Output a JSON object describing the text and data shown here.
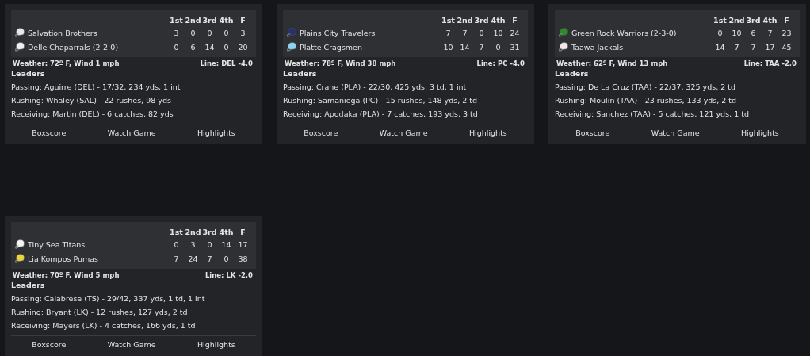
{
  "games": [
    {
      "periods": [
        "1st",
        "2nd",
        "3rd",
        "4th",
        "F"
      ],
      "teams": [
        {
          "name": "Salvation Brothers",
          "color": "#e8e8ee",
          "scores": [
            "3",
            "0",
            "0",
            "0",
            "3"
          ]
        },
        {
          "name": "Delle Chaparrals (2-2-0)",
          "color": "#f0f0f4",
          "scores": [
            "0",
            "6",
            "14",
            "0",
            "20"
          ]
        }
      ],
      "weather": "Weather: 72º F, Wind 1 mph",
      "line": "Line: DEL -4.0",
      "leaders_title": "Leaders",
      "leaders": [
        "Passing: Aguirre (DEL) - 17/32, 234 yds, 1 int",
        "Rushing: Whaley (SAL) - 22 rushes, 98 yds",
        "Receiving: Martin (DEL) - 6 catches, 82 yds"
      ],
      "links": [
        "Boxscore",
        "Watch Game",
        "Highlights"
      ]
    },
    {
      "periods": [
        "1st",
        "2nd",
        "3rd",
        "4th",
        "F"
      ],
      "teams": [
        {
          "name": "Plains City Travelers",
          "color": "#2a2f6e",
          "scores": [
            "7",
            "7",
            "0",
            "10",
            "24"
          ]
        },
        {
          "name": "Platte Cragsmen",
          "color": "#8fd3ee",
          "scores": [
            "10",
            "14",
            "7",
            "0",
            "31"
          ]
        }
      ],
      "weather": "Weather: 78º F, Wind 38 mph",
      "line": "Line: PC -4.0",
      "leaders_title": "Leaders",
      "leaders": [
        "Passing: Crane (PLA) - 22/30, 425 yds, 3 td, 1 int",
        "Rushing: Samaniega (PC) - 15 rushes, 148 yds, 2 td",
        "Receiving: Apodaka (PLA) - 7 catches, 193 yds, 3 td"
      ],
      "links": [
        "Boxscore",
        "Watch Game",
        "Highlights"
      ]
    },
    {
      "periods": [
        "1st",
        "2nd",
        "3rd",
        "4th",
        "F"
      ],
      "teams": [
        {
          "name": "Green Rock Warriors (2-3-0)",
          "color": "#2f8a2a",
          "scores": [
            "0",
            "10",
            "6",
            "7",
            "23"
          ]
        },
        {
          "name": "Taawa Jackals",
          "color": "#f2e6e6",
          "scores": [
            "14",
            "7",
            "7",
            "17",
            "45"
          ]
        }
      ],
      "weather": "Weather: 62º F, Wind 13 mph",
      "line": "Line: TAA -2.0",
      "leaders_title": "Leaders",
      "leaders": [
        "Passing: De La Cruz (TAA) - 22/37, 325 yds, 2 td",
        "Rushing: Moulin (TAA) - 23 rushes, 133 yds, 2 td",
        "Receiving: Sanchez (TAA) - 5 catches, 121 yds, 1 td"
      ],
      "links": [
        "Boxscore",
        "Watch Game",
        "Highlights"
      ]
    },
    {
      "periods": [
        "1st",
        "2nd",
        "3rd",
        "4th",
        "F"
      ],
      "teams": [
        {
          "name": "Tiny Sea Titans",
          "color": "#f4f4f6",
          "scores": [
            "0",
            "3",
            "0",
            "14",
            "17"
          ]
        },
        {
          "name": "Lia Kompos Pumas",
          "color": "#e8d63a",
          "scores": [
            "7",
            "24",
            "7",
            "0",
            "38"
          ]
        }
      ],
      "weather": "Weather: 70º F, Wind 5 mph",
      "line": "Line: LK -2.0",
      "leaders_title": "Leaders",
      "leaders": [
        "Passing: Calabrese (TS) - 29/42, 337 yds, 1 td, 1 int",
        "Rushing: Bryant (LK) - 12 rushes, 127 yds, 2 td",
        "Receiving: Mayers (LK) - 4 catches, 166 yds, 1 td"
      ],
      "links": [
        "Boxscore",
        "Watch Game",
        "Highlights"
      ]
    }
  ]
}
